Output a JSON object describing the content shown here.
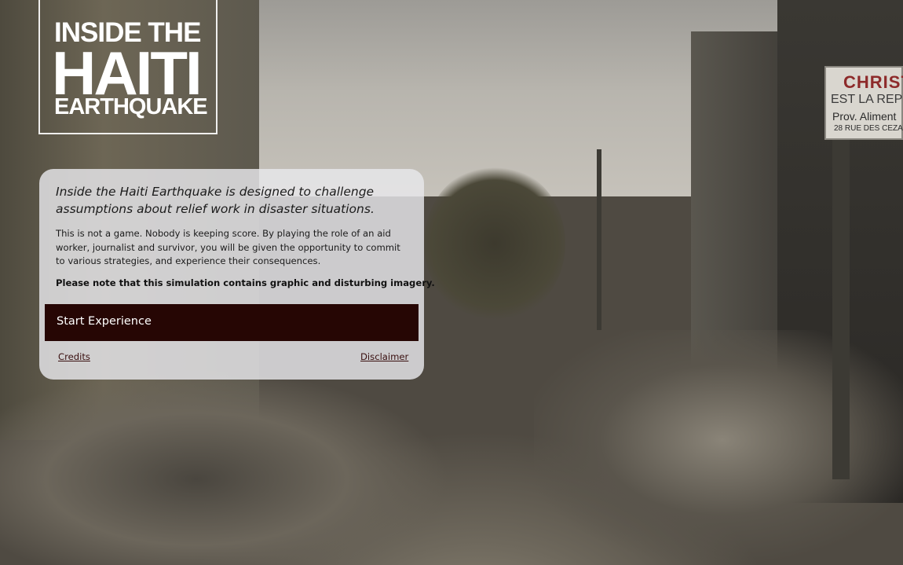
{
  "logo": {
    "line1": "INSIDE THE",
    "line2": "HAITI",
    "line3": "EARTHQUAKE"
  },
  "background_sign": {
    "line1": "CHRIST",
    "line2": "EST LA REPON",
    "line3": "Prov. Aliment",
    "line4": "28 RUE DES CEZA"
  },
  "intro": {
    "headline": "Inside the Haiti Earthquake is designed to challenge assumptions about relief work in disaster situations.",
    "body": "This is not a game. Nobody is keeping score. By playing the role of an aid worker, journalist and survivor, you will be given the opportunity to commit to various strategies, and experience their consequences.",
    "warning": "Please note that this simulation contains graphic and disturbing imagery.",
    "start_label": "Start Experience",
    "credits_label": "Credits",
    "disclaimer_label": "Disclaimer"
  },
  "colors": {
    "start_button_bg": "#260604",
    "panel_bg": "#e8e8ec",
    "logo_text": "#ffffff"
  }
}
